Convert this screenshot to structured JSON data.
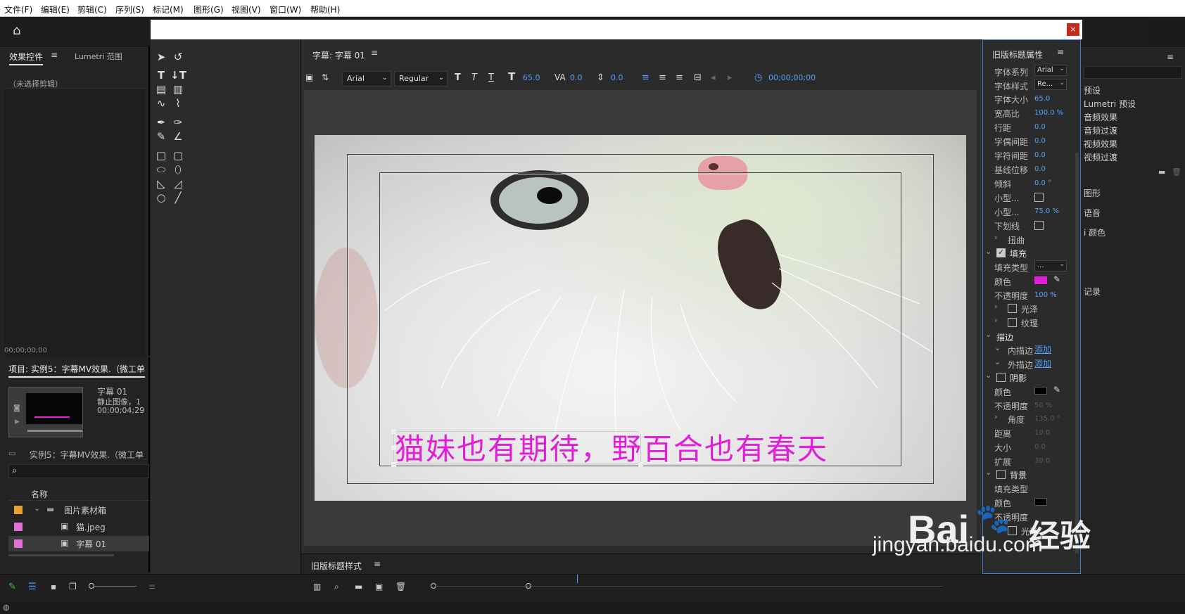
{
  "menubar": [
    "文件(F)",
    "编辑(E)",
    "剪辑(C)",
    "序列(S)",
    "标记(M)",
    "图形(G)",
    "视图(V)",
    "窗口(W)",
    "帮助(H)"
  ],
  "effects_panel": {
    "tab_effects": "效果控件",
    "tab_lumetri": "Lumetri 范围",
    "no_clip": "（未选择剪辑）",
    "timecode": "00;00;00;00"
  },
  "project_panel": {
    "title": "项目: 实例5：字幕MV效果.（微工单",
    "clip_name": "字幕 01",
    "clip_type": "静止图像，1",
    "clip_duration": "00;00;04;29",
    "bin_path": "实例5：字幕MV效果.（微工单",
    "col_name": "名称",
    "items": [
      {
        "label": "图片素材箱",
        "color": "#e8a030"
      },
      {
        "label": "猫.jpeg",
        "color": "#e070d8"
      },
      {
        "label": "字幕 01",
        "color": "#e070d8"
      }
    ]
  },
  "title_dialog": {
    "close_label": "×",
    "canvas_tab": "字幕: 字幕 01",
    "font_family": "Arial",
    "font_style": "Regular",
    "font_size": "65.0",
    "kerning": "0.0",
    "leading": "0.0",
    "timecode": "00;00;00;00",
    "caption_text": "猫妹也有期待，野百合也有春天",
    "caption_color": "#e020d8",
    "styles_tab": "旧版标题样式"
  },
  "properties": {
    "title": "旧版标题属性",
    "font_family_label": "字体系列",
    "font_family_value": "Arial",
    "font_style_label": "字体样式",
    "font_style_value": "Re...",
    "font_size_label": "字体大小",
    "font_size_value": "65.0",
    "aspect_label": "宽高比",
    "aspect_value": "100.0 %",
    "leading_label": "行距",
    "leading_value": "0.0",
    "kerning_label": "字偶间距",
    "kerning_value": "0.0",
    "tracking_label": "字符间距",
    "tracking_value": "0.0",
    "baseline_label": "基线位移",
    "baseline_value": "0.0",
    "slant_label": "倾斜",
    "slant_value": "0.0 °",
    "smallcaps_label": "小型...",
    "smallcaps_size_label": "小型...",
    "smallcaps_size_value": "75.0 %",
    "underline_label": "下划线",
    "distort_label": "扭曲",
    "fill_label": "填充",
    "fill_type_label": "填充类型",
    "fill_type_value": "...",
    "color_label": "颜色",
    "fill_color": "#e020d8",
    "opacity_label": "不透明度",
    "opacity_value": "100 %",
    "sheen_label": "光泽",
    "texture_label": "纹理",
    "stroke_label": "描边",
    "inner_stroke_label": "内描边",
    "outer_stroke_label": "外描边",
    "add_label": "添加",
    "shadow_label": "阴影",
    "shadow_color_label": "颜色",
    "shadow_color": "#000000",
    "shadow_opacity_label": "不透明度",
    "shadow_opacity_value": "50 %",
    "angle_label": "角度",
    "angle_value": "135.0 °",
    "distance_label": "距离",
    "distance_value": "10.0",
    "size_label": "大小",
    "size_value": "0.0",
    "spread_label": "扩展",
    "spread_value": "30.0",
    "background_label": "背景",
    "bg_fill_type_label": "填充类型",
    "bg_color_label": "颜色",
    "bg_opacity_label": "不透明度",
    "bg_sheen_label": "光泽"
  },
  "right_panel": {
    "items": [
      "预设",
      "Lumetri 预设",
      "音频效果",
      "音频过渡",
      "视频效果",
      "视频过渡",
      "图形",
      "语音",
      "i 颜色",
      "记录"
    ]
  },
  "watermark": {
    "brand": "Bai",
    "brand2": "经验",
    "url": "jingyan.baidu.com"
  }
}
